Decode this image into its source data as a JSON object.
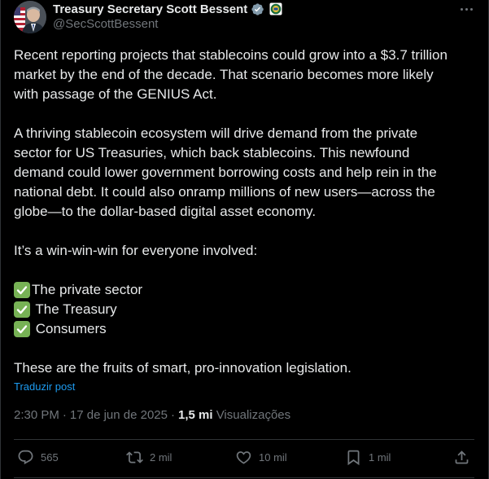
{
  "author": {
    "display_name": "Treasury Secretary Scott Bessent",
    "handle": "@SecScottBessent",
    "verified_color": "#829aab"
  },
  "tweet": {
    "paragraphs": [
      [
        "Recent reporting projects that stablecoins could grow into a $3.7 trillion",
        "market by the end of the decade. That scenario becomes more likely",
        "with passage of the GENIUS Act."
      ],
      [
        "A thriving stablecoin ecosystem will drive demand from the private",
        "sector for US Treasuries, which back stablecoins. This newfound",
        "demand could lower government borrowing costs and help rein in the",
        "national debt. It could also onramp millions of new users—across the",
        "globe—to the dollar-based digital asset economy."
      ],
      [
        "It’s a win-win-win for everyone involved:"
      ]
    ],
    "checklist": [
      "The private sector",
      " The Treasury",
      " Consumers"
    ],
    "closing": "These are the fruits of smart, pro-innovation legislation.",
    "translate_label": "Traduzir post"
  },
  "meta": {
    "time": "2:30 PM",
    "date": "17 de jun de 2025",
    "views_count": "1,5 mi",
    "views_label": "Visualizações"
  },
  "actions": {
    "replies": "565",
    "reposts": "2 mil",
    "likes": "10 mil",
    "bookmarks": "1 mil"
  },
  "colors": {
    "background": "#000000",
    "text": "#e7e9ea",
    "secondary": "#71767b",
    "link": "#1d9bf0",
    "divider": "#2f3336",
    "check": "#77b255"
  }
}
